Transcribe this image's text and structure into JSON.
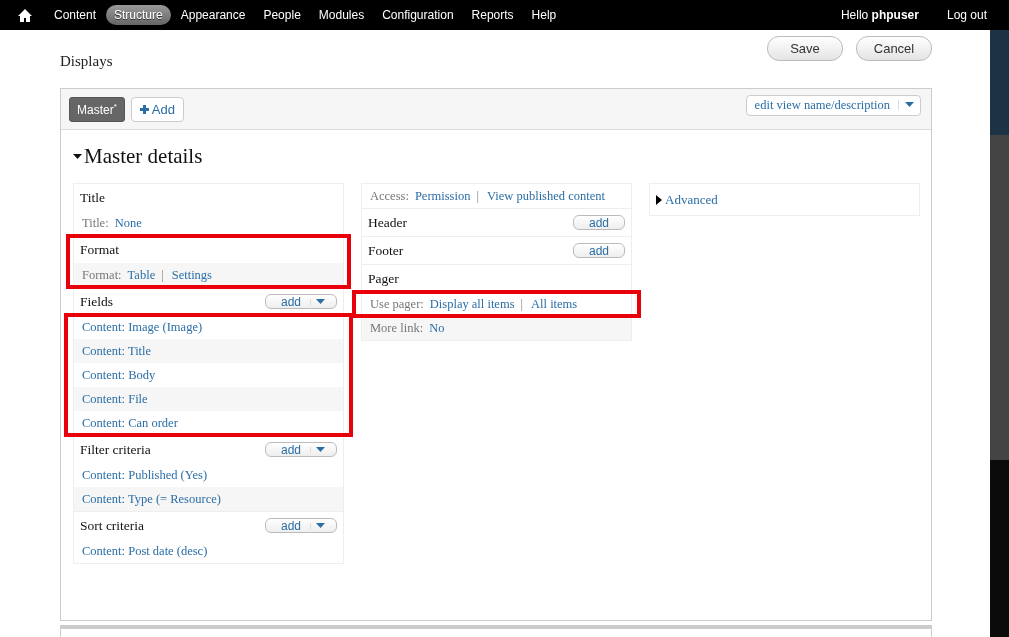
{
  "toolbar": {
    "items": [
      {
        "label": "Content",
        "selected": false
      },
      {
        "label": "Structure",
        "selected": true
      },
      {
        "label": "Appearance",
        "selected": false
      },
      {
        "label": "People",
        "selected": false
      },
      {
        "label": "Modules",
        "selected": false
      },
      {
        "label": "Configuration",
        "selected": false
      },
      {
        "label": "Reports",
        "selected": false
      },
      {
        "label": "Help",
        "selected": false
      }
    ],
    "greeting": "Hello **phpuser**",
    "logout": "Log out"
  },
  "page": {
    "title": "Displays",
    "buttons": [
      "Save",
      "Cancel"
    ]
  },
  "displays": {
    "tabs": [
      {
        "label": "Master$^{*}$",
        "selected": true
      }
    ],
    "add": "Add",
    "edit_menu": "edit view name/description"
  },
  "details": {
    "title": "Master details",
    "expanded": true,
    "columns": [
      [
        {
          "title": "Title",
          "highlighted": false,
          "rows": [
            {
              "kind": "setting",
              "label": "Title:",
              "links": [
                "None"
              ],
              "highlighted": false
            }
          ]
        },
        {
          "title": "Format",
          "highlighted": true,
          "rows": [
            {
              "kind": "setting",
              "label": "Format:",
              "links": [
                "Table",
                "Settings"
              ],
              "separator": "|",
              "highlighted": false
            }
          ]
        },
        {
          "title": "Fields",
          "add_button": {
            "kind": "split",
            "label": "add"
          },
          "highlighted": false,
          "rows": [
            {
              "kind": "item",
              "links": [
                "Content: Image (Image)"
              ],
              "highlighted": true
            },
            {
              "kind": "item",
              "links": [
                "Content: Title"
              ],
              "highlighted": true
            },
            {
              "kind": "item",
              "links": [
                "Content: Body"
              ],
              "highlighted": true
            },
            {
              "kind": "item",
              "links": [
                "Content: File"
              ],
              "highlighted": true
            },
            {
              "kind": "item",
              "links": [
                "Content: Can order"
              ],
              "highlighted": true
            }
          ]
        },
        {
          "title": "Filter criteria",
          "add_button": {
            "kind": "split",
            "label": "add"
          },
          "highlighted": false,
          "rows": [
            {
              "kind": "item",
              "links": [
                "Content: Published (Yes)"
              ],
              "highlighted": false
            },
            {
              "kind": "item",
              "links": [
                "Content: Type (= Resource)"
              ],
              "highlighted": false
            }
          ]
        },
        {
          "title": "Sort criteria",
          "add_button": {
            "kind": "split",
            "label": "add"
          },
          "highlighted": false,
          "rows": [
            {
              "kind": "item",
              "links": [
                "Content: Post date (desc)"
              ],
              "highlighted": false
            }
          ]
        }
      ],
      [
        {
          "highlighted": false,
          "rows": [
            {
              "kind": "setting",
              "label": "Access:",
              "links": [
                "Permission",
                "View published content"
              ],
              "separator": "|",
              "highlighted": false
            }
          ]
        },
        {
          "title": "Header",
          "add_button": {
            "kind": "plain",
            "label": "add"
          },
          "highlighted": false
        },
        {
          "title": "Footer",
          "add_button": {
            "kind": "plain",
            "label": "add"
          },
          "highlighted": false
        },
        {
          "title": "Pager",
          "highlighted": false,
          "rows": [
            {
              "kind": "setting",
              "label": "Use pager:",
              "links": [
                "Display all items",
                "All items"
              ],
              "separator": "|",
              "highlighted": true
            },
            {
              "kind": "setting",
              "label": "More link:",
              "links": [
                "No"
              ],
              "highlighted": false
            }
          ]
        }
      ]
    ],
    "advanced": {
      "label": "Advanced",
      "expanded": false
    }
  }
}
